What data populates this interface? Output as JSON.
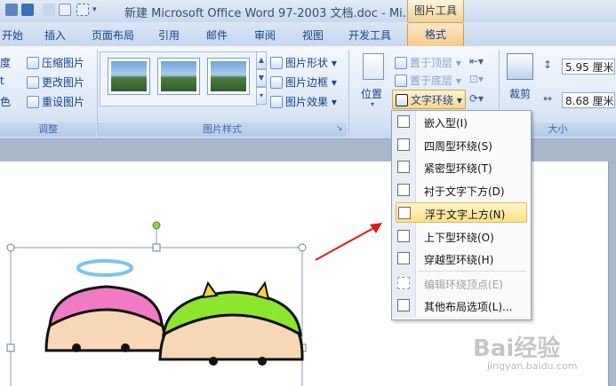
{
  "window": {
    "title": "新建 Microsoft Office Word 97-2003 文档.doc - Mi...",
    "context_tab_header": "图片工具"
  },
  "tabs": [
    {
      "label": "开始"
    },
    {
      "label": "插入"
    },
    {
      "label": "页面布局"
    },
    {
      "label": "引用"
    },
    {
      "label": "邮件"
    },
    {
      "label": "审阅"
    },
    {
      "label": "视图"
    },
    {
      "label": "开发工具"
    },
    {
      "label": "格式",
      "active": true
    }
  ],
  "ribbon": {
    "adjust": {
      "label": "调整",
      "items": [
        "压缩图片",
        "更改图片",
        "重设图片"
      ],
      "partial_items": [
        "度",
        "t",
        "色"
      ]
    },
    "picture_styles": {
      "label": "图片样式",
      "items": [
        "图片形状",
        "图片边框",
        "图片效果"
      ]
    },
    "arrange": {
      "position_label": "位置",
      "bring_front": "置于顶层",
      "send_back": "置于底层",
      "text_wrap": "文字环绕"
    },
    "size": {
      "label": "大小",
      "crop_label": "裁剪",
      "height": "5.95 厘米",
      "width": "8.68 厘米"
    }
  },
  "wrap_menu": {
    "items": [
      {
        "label": "嵌入型(I)"
      },
      {
        "label": "四周型环绕(S)"
      },
      {
        "label": "紧密型环绕(T)"
      },
      {
        "label": "衬于文字下方(D)"
      },
      {
        "label": "浮于文字上方(N)",
        "highlighted": true
      },
      {
        "label": "上下型环绕(O)"
      },
      {
        "label": "穿越型环绕(H)"
      },
      {
        "label": "编辑环绕顶点(E)",
        "disabled": true
      },
      {
        "label": "其他布局选项(L)..."
      }
    ]
  },
  "watermark": {
    "text": "Bai经验",
    "url": "jingyan.baidu.com"
  },
  "colors": {
    "accent_red": "#e0161b",
    "highlight": "#fddf8a",
    "ribbon_text": "#15428b"
  }
}
